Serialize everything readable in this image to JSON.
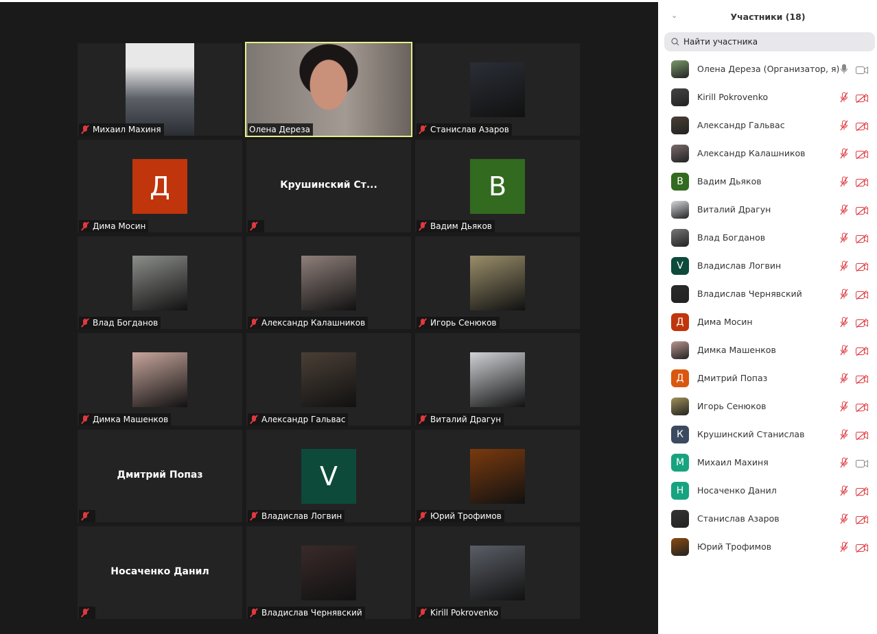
{
  "gallery": {
    "tiles": [
      {
        "name": "Михаил Махиня",
        "type": "video",
        "color": "#5b5f66",
        "muted": true
      },
      {
        "name": "Олена Дереза",
        "type": "videofull",
        "color": "#8a7c72",
        "muted": false,
        "active": true
      },
      {
        "name": "Станислав Азаров",
        "type": "photo",
        "color": "#2a2e36",
        "muted": true
      },
      {
        "name": "Дима Мосин",
        "type": "letter",
        "letter": "Д",
        "color": "#c0350c",
        "muted": true
      },
      {
        "name": "",
        "big": "Крушинский  Ст...",
        "type": "text",
        "muted": true
      },
      {
        "name": "Вадим Дьяков",
        "type": "letter",
        "letter": "B",
        "color": "#326a1f",
        "muted": true
      },
      {
        "name": "Влад Богданов",
        "type": "photo",
        "color": "#8c8e8a",
        "muted": true
      },
      {
        "name": "Александр Калашников",
        "type": "photo",
        "color": "#8f7f7a",
        "muted": true
      },
      {
        "name": "Игорь Сенюков",
        "type": "photo",
        "color": "#9a8e6a",
        "muted": true
      },
      {
        "name": "Димка Машенков",
        "type": "photo",
        "color": "#c7a59c",
        "muted": true
      },
      {
        "name": "Александр Гальвас",
        "type": "photo",
        "color": "#4a3f36",
        "muted": true
      },
      {
        "name": "Виталий Драгун",
        "type": "photo",
        "color": "#cfd2d6",
        "muted": true
      },
      {
        "name": "",
        "big": "Дмитрий Попаз",
        "type": "text",
        "muted": true
      },
      {
        "name": "Владислав Логвин",
        "type": "letter",
        "letter": "V",
        "color": "#0d4a3a",
        "muted": true
      },
      {
        "name": "Юрий Трофимов",
        "type": "photo",
        "color": "#7a3a0e",
        "muted": true
      },
      {
        "name": "",
        "big": "Носаченко Данил",
        "type": "text",
        "muted": true
      },
      {
        "name": "Владислав Чернявский",
        "type": "photo",
        "color": "#3a2a2a",
        "muted": true
      },
      {
        "name": "Kirill Pokrovenko",
        "type": "photo",
        "color": "#5a5e66",
        "muted": true
      }
    ]
  },
  "panel": {
    "title": "Участники (18)",
    "search_placeholder": "Найти участника",
    "participants": [
      {
        "name": "Олена Дереза (Организатор, я)",
        "color": "#7a9a6a",
        "mic": "on",
        "cam": "on"
      },
      {
        "name": "Kirill Pokrovenko",
        "color": "#444",
        "mic": "off",
        "cam": "off"
      },
      {
        "name": "Александр Гальвас",
        "color": "#4a3f36",
        "mic": "off",
        "cam": "off"
      },
      {
        "name": "Александр Калашников",
        "color": "#7a6a6a",
        "mic": "off",
        "cam": "off"
      },
      {
        "name": "Вадим Дьяков",
        "letter": "B",
        "color": "#326a1f",
        "mic": "off",
        "cam": "off"
      },
      {
        "name": "Виталий Драгун",
        "color": "#d5d7da",
        "mic": "off",
        "cam": "off"
      },
      {
        "name": "Влад Богданов",
        "color": "#777",
        "mic": "off",
        "cam": "off"
      },
      {
        "name": "Владислав Логвин",
        "letter": "V",
        "color": "#0d4a3a",
        "mic": "off",
        "cam": "off"
      },
      {
        "name": "Владислав Чернявский",
        "color": "#2a2a2a",
        "mic": "off",
        "cam": "off"
      },
      {
        "name": "Дима Мосин",
        "letter": "Д",
        "color": "#c0350c",
        "mic": "off",
        "cam": "off"
      },
      {
        "name": "Димка Машенков",
        "color": "#b89590",
        "mic": "off",
        "cam": "off"
      },
      {
        "name": "Дмитрий Попаз",
        "letter": "Д",
        "color": "#d9570f",
        "mic": "off",
        "cam": "off"
      },
      {
        "name": "Игорь Сенюков",
        "color": "#a0905a",
        "mic": "off",
        "cam": "off"
      },
      {
        "name": "Крушинский Станислав",
        "letter": "К",
        "color": "#3b4a5e",
        "mic": "off",
        "cam": "off"
      },
      {
        "name": "Михаил Махиня",
        "letter": "М",
        "color": "#17a37f",
        "mic": "off",
        "cam": "on"
      },
      {
        "name": "Носаченко Данил",
        "letter": "Н",
        "color": "#17a37f",
        "mic": "off",
        "cam": "off"
      },
      {
        "name": "Станислав Азаров",
        "color": "#333",
        "mic": "off",
        "cam": "off"
      },
      {
        "name": "Юрий Трофимов",
        "color": "#8a4a10",
        "mic": "off",
        "cam": "off"
      }
    ]
  }
}
